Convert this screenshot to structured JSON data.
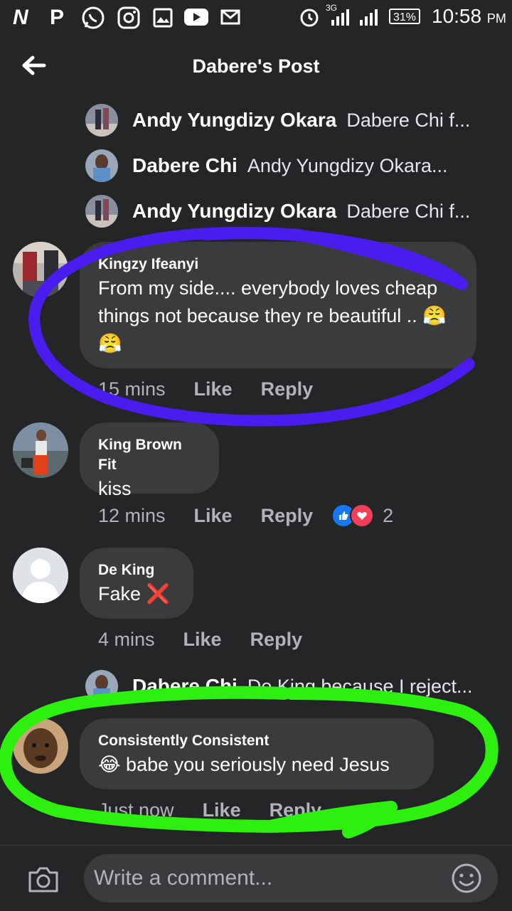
{
  "status_bar": {
    "battery": "31%",
    "time": "10:58",
    "ampm": "PM",
    "network": "3G"
  },
  "header": {
    "title": "Dabere's Post"
  },
  "replies_top": [
    {
      "name": "Andy Yungdizy Okara",
      "text": "Dabere Chi f..."
    },
    {
      "name": "Dabere Chi",
      "text": "Andy Yungdizy Okara..."
    },
    {
      "name": "Andy Yungdizy Okara",
      "text": "Dabere Chi f..."
    }
  ],
  "comments": [
    {
      "name": "Kingzy Ifeanyi",
      "text": "From my side.... everybody loves cheap things not because they re beautiful .. 😤😤",
      "time": "15 mins",
      "like": "Like",
      "reply": "Reply"
    },
    {
      "name": "King Brown Fit",
      "text": "kiss",
      "time": "12 mins",
      "like": "Like",
      "reply": "Reply",
      "reaction_count": "2"
    },
    {
      "name": "De King",
      "text": "Fake ❌",
      "time": "4 mins",
      "like": "Like",
      "reply": "Reply"
    },
    {
      "name": "Consistently Consistent",
      "text": "😂 babe you seriously need Jesus",
      "time": "Just now",
      "like": "Like",
      "reply": "Reply"
    }
  ],
  "reply_mid": {
    "name": "Dabere Chi",
    "text": "De King because I reject..."
  },
  "composer": {
    "placeholder": "Write a comment..."
  },
  "colors": {
    "background": "#242526",
    "bubble": "#3a3b3c",
    "annotation_blue": "#4b1cf0",
    "annotation_green": "#2ef00f"
  }
}
